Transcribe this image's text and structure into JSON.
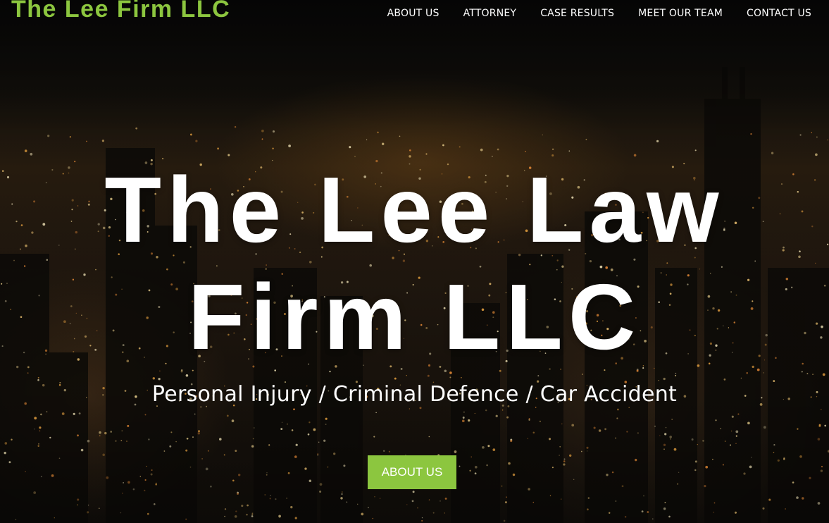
{
  "header": {
    "brand": "The Lee Firm LLC",
    "nav": {
      "about": "ABOUT US",
      "attorney": "ATTORNEY",
      "case_results": "CASE RESULTS",
      "meet_team": "MEET OUR TEAM",
      "contact": "CONTACT US"
    }
  },
  "hero": {
    "title_line1": "The Lee Law",
    "title_line2": "Firm LLC",
    "subtitle": "Personal Injury / Criminal Defence / Car Accident",
    "button_label": "ABOUT US"
  },
  "colors": {
    "accent": "#8cc63f",
    "text": "#ffffff"
  }
}
